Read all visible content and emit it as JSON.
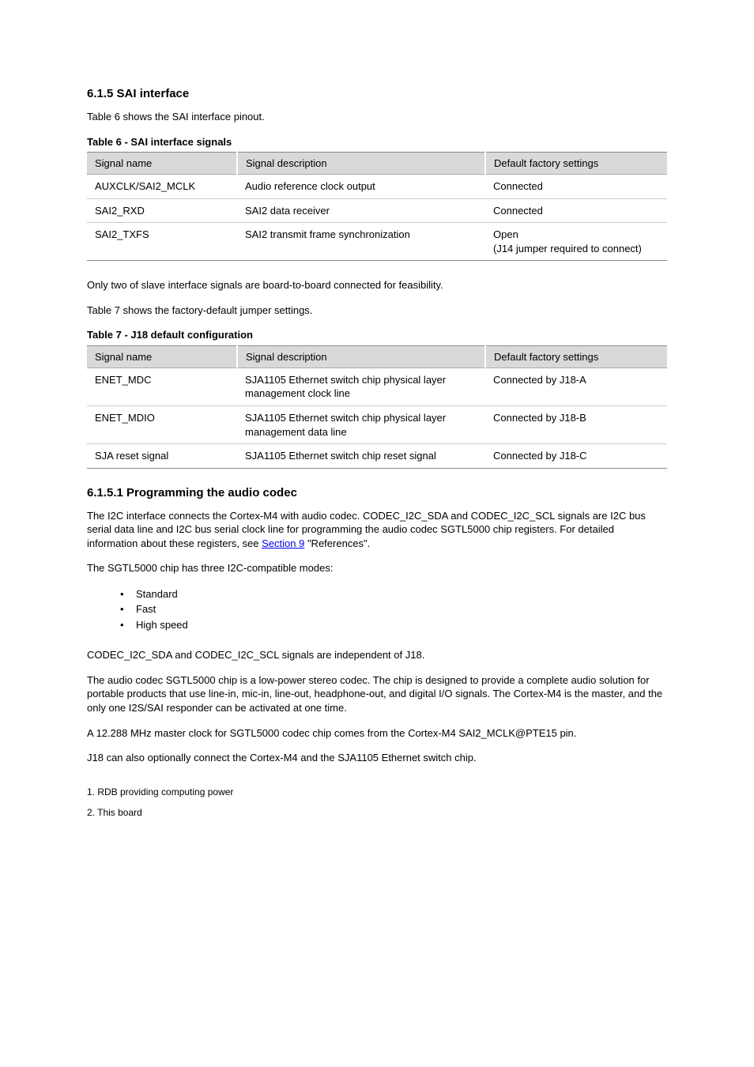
{
  "section": {
    "heading": "6.1.5 SAI interface",
    "para1": "Table 6 shows the SAI interface pinout.",
    "para2": "Only two of slave interface signals are board-to-board connected for feasibility.",
    "para3": "Table 7 shows the factory-default jumper settings.",
    "table6_caption": "Table 6 - SAI interface signals",
    "table7_caption": "Table 7 - J18 default configuration",
    "table6": {
      "headers": [
        "Signal name",
        "Signal description",
        "Default factory settings"
      ],
      "rows": [
        [
          "AUXCLK/SAI2_MCLK",
          "Audio reference clock output",
          "Connected"
        ],
        [
          "SAI2_RXD",
          "SAI2 data receiver",
          "Connected"
        ],
        [
          "SAI2_TXFS",
          "SAI2 transmit frame synchronization",
          "Open\n(J14 jumper required to connect)"
        ]
      ]
    },
    "table7": {
      "headers": [
        "Signal name",
        "Signal description",
        "Default factory settings"
      ],
      "rows": [
        [
          "ENET_MDC",
          "SJA1105 Ethernet switch chip physical layer management clock line",
          "Connected by J18-A"
        ],
        [
          "ENET_MDIO",
          "SJA1105 Ethernet switch chip physical layer management data line",
          "Connected by J18-B"
        ],
        [
          "SJA reset signal",
          "SJA1105 Ethernet switch chip reset signal",
          "Connected by J18-C"
        ]
      ]
    }
  },
  "subsection": {
    "heading": "6.1.5.1 Programming the audio codec",
    "para1": "The I2C interface connects the Cortex-M4 with audio codec. CODEC_I2C_SDA and CODEC_I2C_SCL signals are I2C bus serial data line and I2C bus serial clock line for programming the audio codec SGTL5000 chip registers. For detailed information about these registers, see ",
    "link_text": "Section 9",
    "para1b": " \"References\".",
    "para2": "The SGTL5000 chip has three I2C-compatible modes:",
    "bullets": [
      "Standard",
      "Fast",
      "High speed"
    ],
    "para3": "CODEC_I2C_SDA and CODEC_I2C_SCL signals are independent of J18.",
    "para4": "The audio codec SGTL5000 chip is a low-power stereo codec. The chip is designed to provide a complete audio solution for portable products that use line-in, mic-in, line-out, headphone-out, and digital I/O signals. The Cortex-M4 is the master, and the only one I2S/SAI responder can be activated at one time.",
    "para5": "A 12.288 MHz master clock for SGTL5000 codec chip comes from the Cortex-M4 SAI2_MCLK@PTE15 pin.",
    "para6": "J18 can also optionally connect the Cortex-M4 and the SJA1105 Ethernet switch chip."
  },
  "footnotes": {
    "line1": "1. RDB providing computing power",
    "line2": "2. This board"
  }
}
